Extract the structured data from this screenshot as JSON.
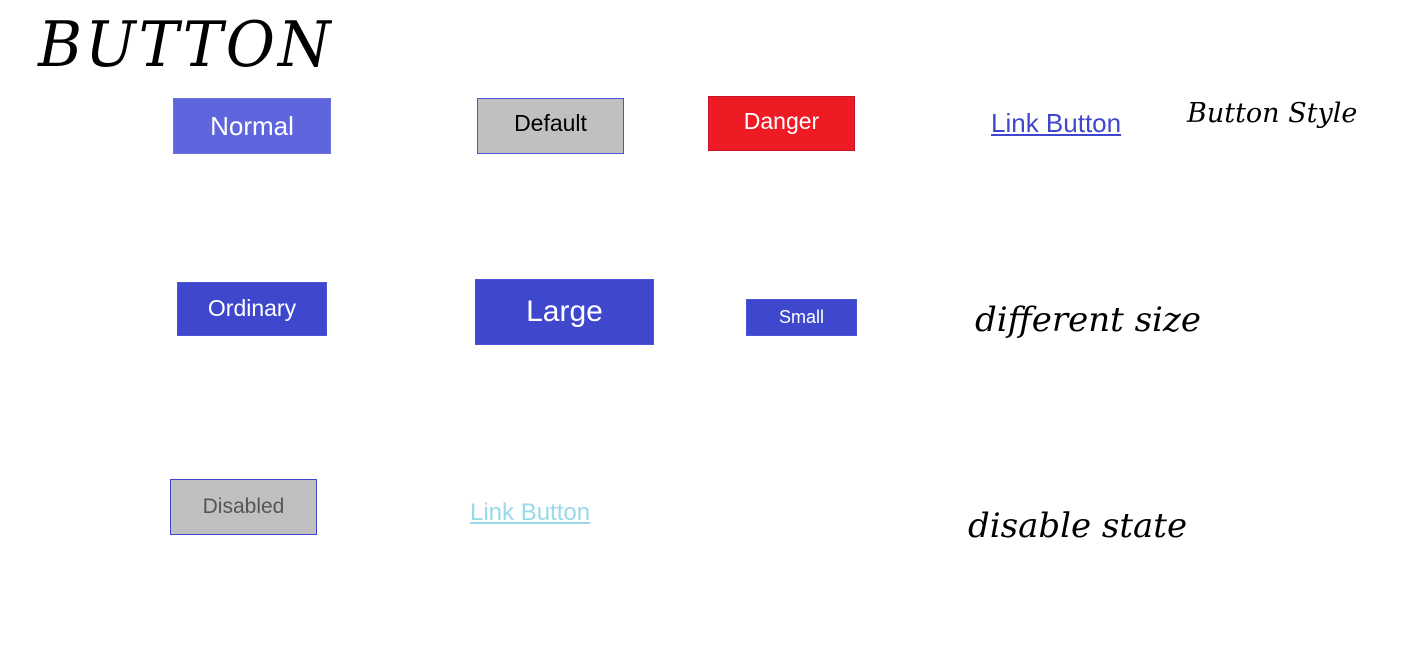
{
  "title": "BUTTON",
  "row_style": {
    "normal": "Normal",
    "default": "Default",
    "danger": "Danger",
    "link": "Link Button",
    "caption": "Button Style"
  },
  "row_size": {
    "ordinary": "Ordinary",
    "large": "Large",
    "small": "Small",
    "caption": "different size"
  },
  "row_disabled": {
    "disabled": "Disabled",
    "link": "Link Button",
    "caption": "disable state"
  },
  "colors": {
    "primary": "#3f48cc",
    "primary_light": "#5e65dd",
    "danger": "#ee1b25",
    "default_gray": "#c0c0c0",
    "disabled_link": "#99d9ea"
  }
}
